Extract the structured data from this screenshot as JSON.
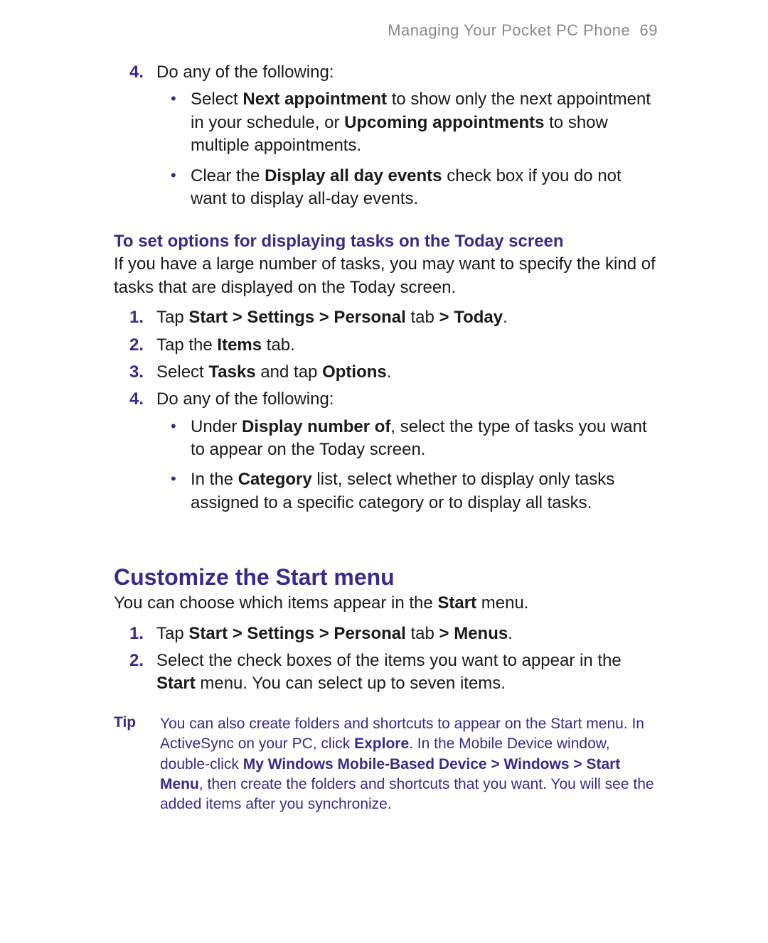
{
  "header": {
    "running_title": "Managing Your Pocket PC Phone",
    "page_number": "69"
  },
  "section1": {
    "step4": {
      "num": "4.",
      "text": "Do any of the following:",
      "bullets": {
        "b1": {
          "pre": "Select ",
          "bold1": "Next appointment",
          "mid": " to show only the next appointment in your schedule, or ",
          "bold2": "Upcoming appointments",
          "post": " to show multiple appointments."
        },
        "b2": {
          "pre": "Clear the ",
          "bold1": "Display all day events",
          "post": " check box if you do not want to display all-day events."
        }
      }
    }
  },
  "section2": {
    "title": "To set options for displaying tasks on the Today screen",
    "intro": "If you have a large number of tasks, you may want to specify the kind of tasks that are displayed on the Today screen.",
    "steps": {
      "s1": {
        "num": "1.",
        "pre": "Tap ",
        "bold1": "Start > Settings > Personal",
        "mid": " tab ",
        "bold2": "> Today",
        "post": "."
      },
      "s2": {
        "num": "2.",
        "pre": "Tap the ",
        "bold1": "Items",
        "post": " tab."
      },
      "s3": {
        "num": "3.",
        "pre": "Select ",
        "bold1": "Tasks",
        "mid": " and tap ",
        "bold2": "Options",
        "post": "."
      },
      "s4": {
        "num": "4.",
        "text": "Do any of the following:",
        "bullets": {
          "b1": {
            "pre": "Under ",
            "bold1": "Display number of",
            "post": ", select the type of tasks you want to appear on the Today screen."
          },
          "b2": {
            "pre": "In the ",
            "bold1": "Category",
            "post": " list, select whether to display only tasks assigned to a specific category or to display all tasks."
          }
        }
      }
    }
  },
  "section3": {
    "title": "Customize the Start menu",
    "intro_pre": "You can choose which items appear in the ",
    "intro_bold": "Start",
    "intro_post": " menu.",
    "steps": {
      "s1": {
        "num": "1.",
        "pre": "Tap ",
        "bold1": "Start > Settings > Personal",
        "mid": " tab ",
        "bold2": "> Menus",
        "post": "."
      },
      "s2": {
        "num": "2.",
        "pre": "Select the check boxes of the items you want to appear in the ",
        "bold1": "Start",
        "post": " menu. You can select up to seven items."
      }
    }
  },
  "tip": {
    "label": "Tip",
    "t1": "You can also create folders and shortcuts to appear on the Start menu. In ActiveSync on your PC, click ",
    "b1": "Explore",
    "t2": ". In the Mobile Device window, double-click ",
    "b2": "My Windows Mobile-Based Device > Windows > Start Menu",
    "t3": ", then create the folders and shortcuts that you want. You will see the added items after you synchronize."
  }
}
